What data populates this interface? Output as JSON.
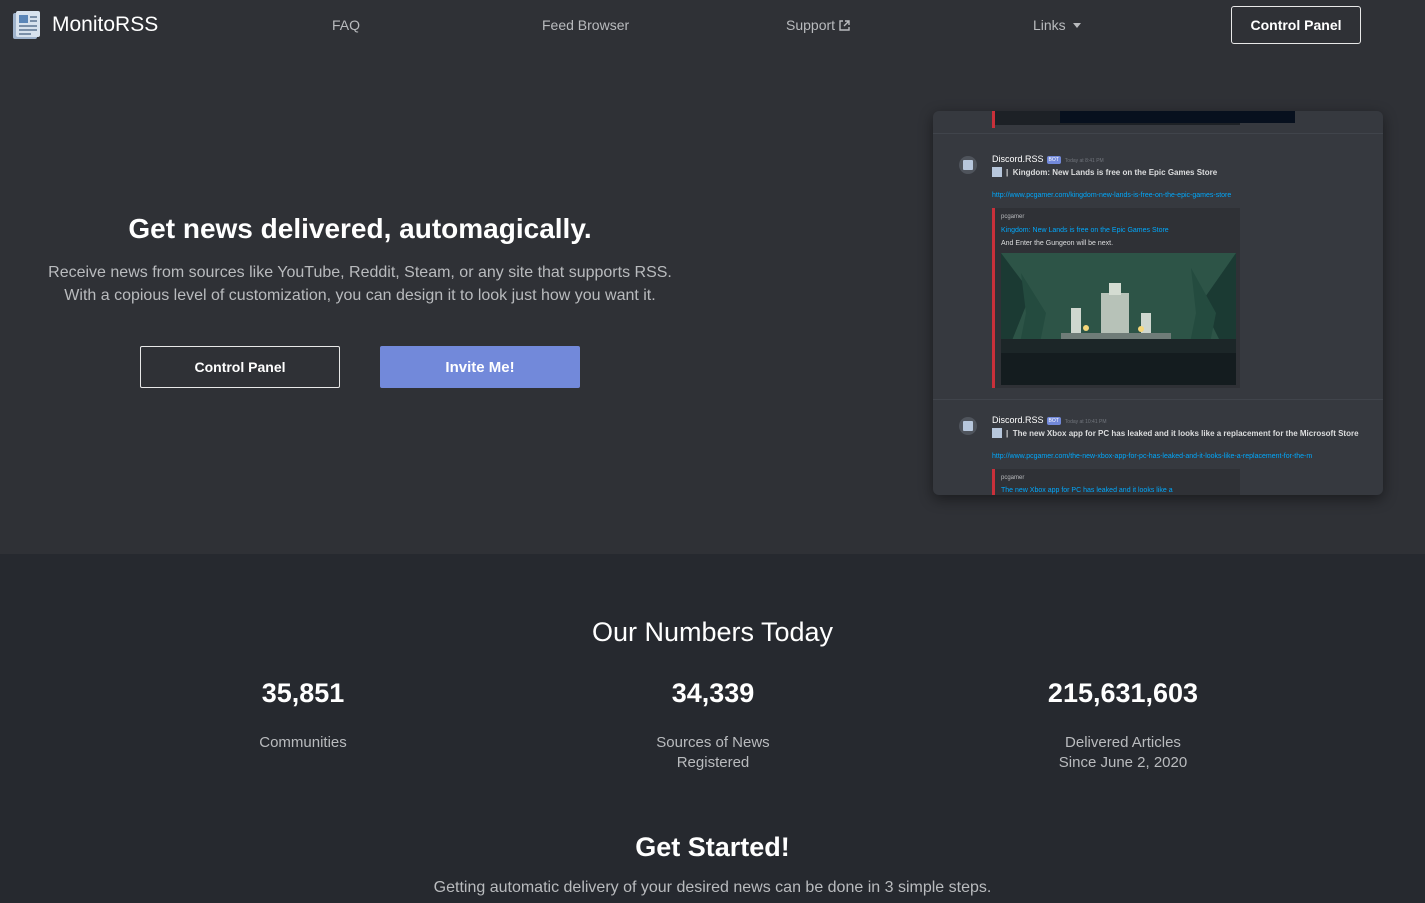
{
  "nav": {
    "brand": "MonitoRSS",
    "faq": "FAQ",
    "feed_browser": "Feed Browser",
    "support": "Support",
    "links": "Links",
    "control_panel": "Control Panel"
  },
  "hero": {
    "title": "Get news delivered, automagically.",
    "subtitle_line1": "Receive news from sources like YouTube, Reddit, Steam, or any site that supports RSS.",
    "subtitle_line2": "With a copious level of customization, you can design it to look just how you want it.",
    "control_panel_button": "Control Panel",
    "invite_button": "Invite Me!"
  },
  "preview": {
    "messages": [
      {
        "author": "Discord.RSS",
        "badge": "BOT",
        "time": "Today at 8:41 PM",
        "text": "Kingdom: New Lands is free on the Epic Games Store",
        "link": "http://www.pcgamer.com/kingdom-new-lands-is-free-on-the-epic-games-store",
        "embed_provider": "pcgamer",
        "embed_title": "Kingdom: New Lands is free on the Epic Games Store",
        "embed_desc": "And Enter the Gungeon will be next."
      },
      {
        "author": "Discord.RSS",
        "badge": "BOT",
        "time": "Today at 10:41 PM",
        "text": "The new Xbox app for PC has leaked and it looks like a replacement for the Microsoft Store",
        "link": "http://www.pcgamer.com/the-new-xbox-app-for-pc-has-leaked-and-it-looks-like-a-replacement-for-the-m",
        "embed_provider": "pcgamer",
        "embed_title": "The new Xbox app for PC has leaked and it looks like a"
      }
    ]
  },
  "numbers": {
    "title": "Our Numbers Today",
    "stats": [
      {
        "value": "35,851",
        "label_line1": "Communities",
        "label_line2": ""
      },
      {
        "value": "34,339",
        "label_line1": "Sources of News",
        "label_line2": "Registered"
      },
      {
        "value": "215,631,603",
        "label_line1": "Delivered Articles",
        "label_line2": "Since June 2, 2020"
      }
    ]
  },
  "get_started": {
    "title": "Get Started!",
    "subtitle": "Getting automatic delivery of your desired news can be done in 3 simple steps."
  },
  "colors": {
    "accent": "#7289da",
    "background": "#26292f",
    "surface": "#2f3136",
    "link": "#00a8fc",
    "embed_bar": "#c9303a"
  }
}
